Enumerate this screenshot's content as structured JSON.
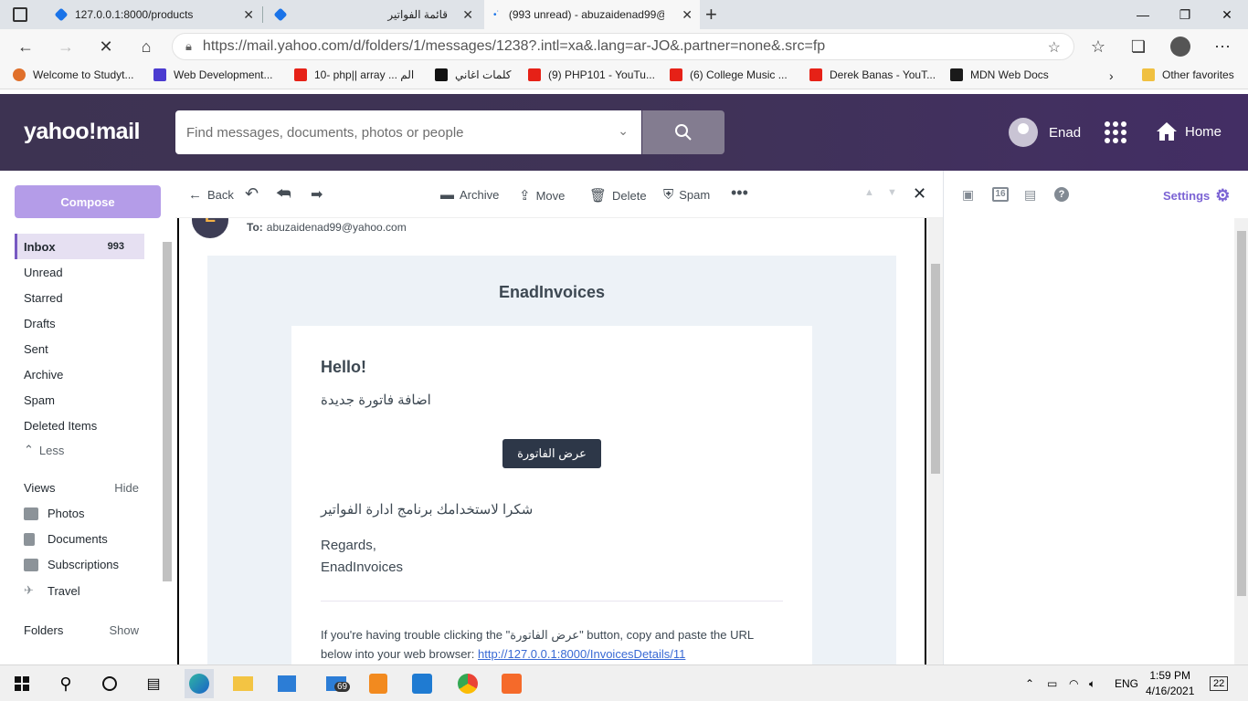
{
  "browser": {
    "tabs": [
      {
        "title": "127.0.0.1:8000/products"
      },
      {
        "title": "قائمة الفواتير"
      },
      {
        "title": "(993 unread) - abuzaidenad99@"
      }
    ],
    "url": "https://mail.yahoo.com/d/folders/1/messages/1238?.intl=xa&.lang=ar-JO&.partner=none&.src=fp",
    "bookmarks": [
      {
        "label": "Welcome to Studyt...",
        "color": "#e0702b"
      },
      {
        "label": "Web Development...",
        "color": "#4b3bd0"
      },
      {
        "label": "10- php|| array ... الم",
        "color": "#e62117"
      },
      {
        "label": "كلمات اغاني",
        "color": "#111111"
      },
      {
        "label": "(9) PHP101 - YouTu...",
        "color": "#e62117"
      },
      {
        "label": "(6) College Music ...",
        "color": "#e62117"
      },
      {
        "label": "Derek Banas - YouT...",
        "color": "#e62117"
      },
      {
        "label": "MDN Web Docs",
        "color": "#1a1a1a"
      },
      {
        "label": "Other favorites",
        "color": "#f0c040"
      }
    ]
  },
  "yahoo": {
    "logo": "yahoo!mail",
    "search_placeholder": "Find messages, documents, photos or people",
    "user_name": "Enad",
    "home_label": "Home",
    "accent": "#7b63d4"
  },
  "sidebar": {
    "compose": "Compose",
    "folders": [
      {
        "label": "Inbox",
        "count": "993"
      },
      {
        "label": "Unread"
      },
      {
        "label": "Starred"
      },
      {
        "label": "Drafts"
      },
      {
        "label": "Sent"
      },
      {
        "label": "Archive"
      },
      {
        "label": "Spam"
      },
      {
        "label": "Deleted Items"
      }
    ],
    "less": "Less",
    "views": {
      "label": "Views",
      "action": "Hide"
    },
    "view_items": [
      "Photos",
      "Documents",
      "Subscriptions",
      "Travel"
    ],
    "folders_section": {
      "label": "Folders",
      "action": "Show"
    }
  },
  "toolbar": {
    "back": "Back",
    "archive": "Archive",
    "move": "Move",
    "delete": "Delete",
    "spam": "Spam"
  },
  "message": {
    "to_label": "To:",
    "to_address": "abuzaidenad99@yahoo.com",
    "brand": "EnadInvoices",
    "greeting": "Hello!",
    "line1": "اضافة فاتورة جديدة",
    "button": "عرض الفاتورة",
    "line2": "شكرا لاستخدامك برنامج ادارة الفواتير",
    "regards": "Regards,",
    "signature": "EnadInvoices",
    "trouble_text": "If you're having trouble clicking the \"عرض الفاتورة\" button, copy and paste the URL below into your web browser:",
    "trouble_link": "http://127.0.0.1:8000/InvoicesDetails/11"
  },
  "rightrail": {
    "settings": "Settings",
    "calendar_day": "16"
  },
  "taskbar": {
    "mail_badge": "69",
    "lang": "ENG",
    "time": "1:59 PM",
    "date": "4/16/2021",
    "notif_count": "22"
  }
}
